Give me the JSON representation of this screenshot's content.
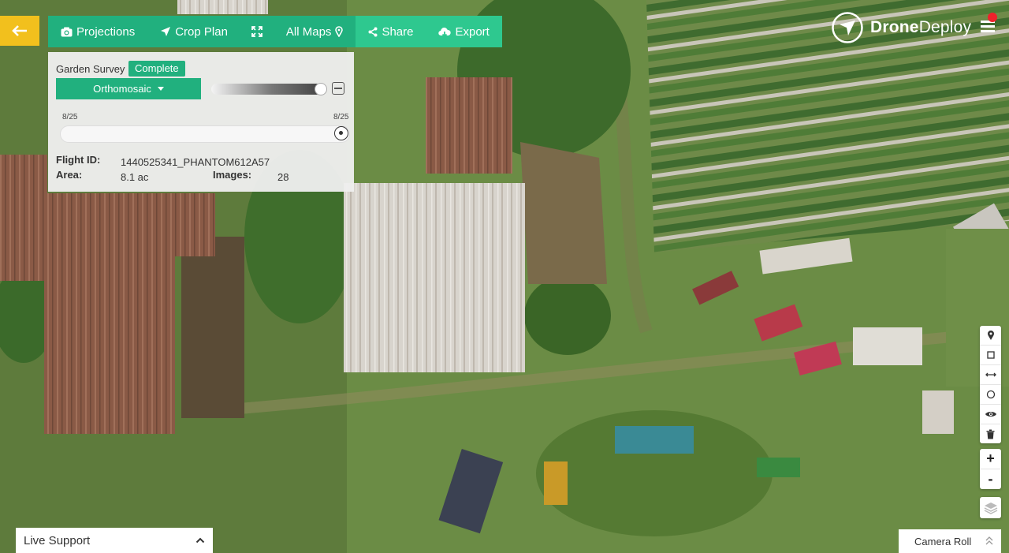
{
  "toolbar": {
    "back_icon": "arrow-left-icon",
    "projections": "Projections",
    "crop_plan": "Crop Plan",
    "fullscreen_icon": "expand-icon",
    "all_maps": "All Maps",
    "share": "Share",
    "export": "Export"
  },
  "panel": {
    "title": "Garden Survey",
    "status": "Complete",
    "layer": "Orthomosaic",
    "opacity_percent": 100,
    "date_start": "8/25",
    "date_end": "8/25",
    "flight_id_label": "Flight ID:",
    "flight_id": "1440525341_PHANTOM612A57",
    "area_label": "Area:",
    "area": "8.1 ac",
    "images_label": "Images:",
    "images": "28"
  },
  "brand": {
    "name_bold": "Drone",
    "name_rest": "Deploy"
  },
  "tools": [
    "location-pin-icon",
    "rectangle-icon",
    "measure-line-icon",
    "circle-icon",
    "eye-icon",
    "trash-icon"
  ],
  "zoom": {
    "in": "+",
    "out": "-"
  },
  "bottom": {
    "live_support": "Live Support",
    "camera_roll": "Camera Roll"
  },
  "colors": {
    "accent_green": "#21b07e",
    "back_yellow": "#f2c01d",
    "notification_red": "#f0212b"
  }
}
